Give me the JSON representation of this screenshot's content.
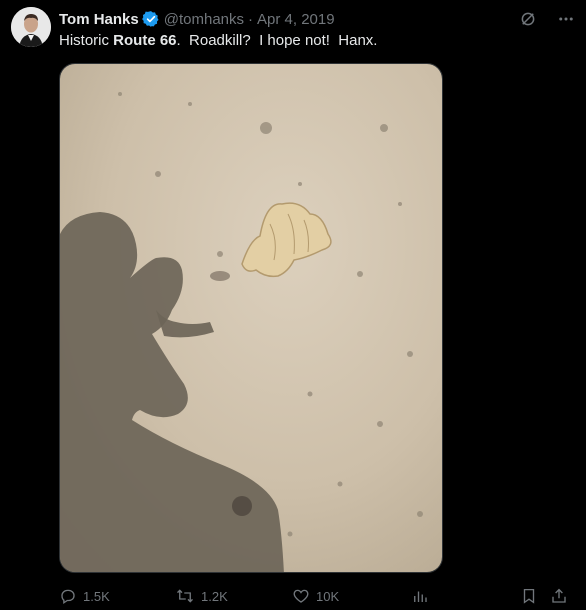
{
  "tweet": {
    "author_name": "Tom Hanks",
    "handle": "@tomhanks",
    "separator": "·",
    "date": "Apr 4, 2019",
    "text_part1": "Historic ",
    "text_bold": "Route 66",
    "text_part2": ".  Roadkill?  I hope not!  Hanx.",
    "media_description_icon": "photo",
    "stats": {
      "replies": "1.5K",
      "retweets": "1.2K",
      "likes": "10K",
      "views": ""
    }
  },
  "icons": {
    "verified": "verified-badge-icon",
    "grok": "grok-icon",
    "more": "more-icon",
    "reply": "reply-icon",
    "retweet": "retweet-icon",
    "like": "heart-icon",
    "views": "views-icon",
    "bookmark": "bookmark-icon",
    "share": "share-icon"
  },
  "colors": {
    "background": "#000000",
    "text": "#e7e9ea",
    "muted": "#71767b",
    "verified": "#1d9bf0"
  }
}
